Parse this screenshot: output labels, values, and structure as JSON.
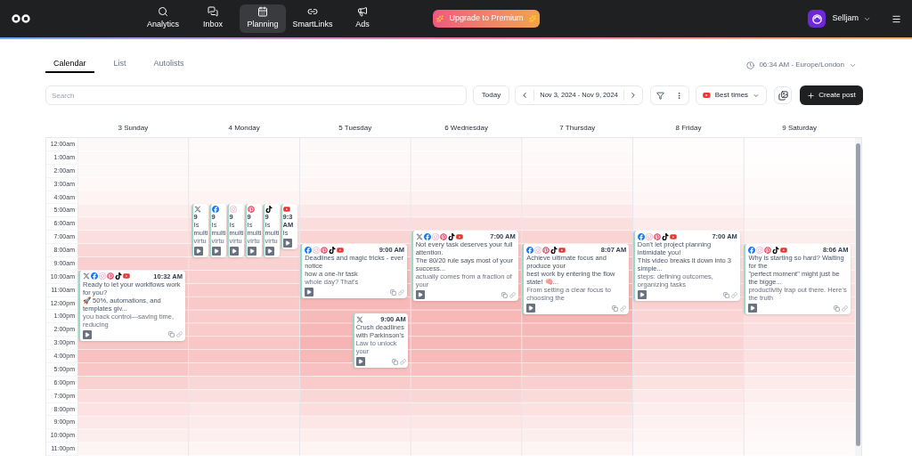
{
  "nav": [
    {
      "label": "Analytics",
      "selected": false
    },
    {
      "label": "Inbox",
      "selected": false
    },
    {
      "label": "Planning",
      "selected": true
    },
    {
      "label": "SmartLinks",
      "selected": false
    },
    {
      "label": "Ads",
      "selected": false
    }
  ],
  "upgrade": "Upgrade to Premium",
  "account": "Selljam",
  "views": [
    {
      "label": "Calendar",
      "selected": true
    },
    {
      "label": "List",
      "selected": false
    },
    {
      "label": "Autolists",
      "selected": false
    }
  ],
  "timezone": "06:34 AM - Europe/London",
  "search": {
    "placeholder": "Search"
  },
  "today": "Today",
  "range": "Nov 3, 2024 - Nov 9, 2024",
  "best_times": "Best times",
  "create": "Create post",
  "hours": [
    "12:00am",
    "1:00am",
    "2:00am",
    "3:00am",
    "4:00am",
    "5:00am",
    "6:00am",
    "7:00am",
    "8:00am",
    "9:00am",
    "10:00am",
    "11:00am",
    "12:00pm",
    "1:00pm",
    "2:00pm",
    "3:00pm",
    "4:00pm",
    "5:00pm",
    "6:00pm",
    "7:00pm",
    "8:00pm",
    "9:00pm",
    "10:00pm",
    "11:00pm"
  ],
  "days": [
    {
      "label": "3 Sunday",
      "posts": [
        {
          "kind": "full",
          "time": "10:32 AM",
          "networks": [
            {
              "kind": "x"
            },
            {
              "kind": "facebook"
            },
            {
              "kind": "instagram"
            },
            {
              "kind": "pinterest"
            },
            {
              "kind": "tiktok"
            },
            {
              "kind": "youtube"
            }
          ],
          "lines": [
            "Ready to let your workflows work for you?",
            "🚀 50%, automations, and templates giv...",
            "you back control—saving time, reducing"
          ]
        }
      ]
    },
    {
      "label": "4 Monday",
      "posts": [
        {
          "kind": "narrow",
          "time": "9",
          "networks": [
            {
              "kind": "x"
            }
          ],
          "lines": [
            "Is",
            "multi",
            "virtu"
          ]
        },
        {
          "kind": "narrow",
          "time": "9",
          "networks": [
            {
              "kind": "facebook"
            }
          ],
          "lines": [
            "Is",
            "multi",
            "virtu"
          ]
        },
        {
          "kind": "narrow",
          "time": "9",
          "networks": [
            {
              "kind": "instagram"
            }
          ],
          "lines": [
            "Is",
            "multi",
            "virtu"
          ]
        },
        {
          "kind": "narrow",
          "time": "9",
          "networks": [
            {
              "kind": "pinterest"
            }
          ],
          "lines": [
            "Is",
            "multi",
            "virtu"
          ]
        },
        {
          "kind": "narrow",
          "time": "9",
          "networks": [
            {
              "kind": "tiktok"
            }
          ],
          "lines": [
            "Is",
            "multi",
            "virtu"
          ]
        },
        {
          "kind": "narrow",
          "time": "9:3 AM",
          "networks": [
            {
              "kind": "youtube"
            }
          ],
          "lines": [
            "Is"
          ]
        }
      ]
    },
    {
      "label": "5 Tuesday",
      "posts": [
        {
          "kind": "full",
          "time": "9:00 AM",
          "networks": [
            {
              "kind": "facebook"
            },
            {
              "kind": "instagram"
            },
            {
              "kind": "pinterest"
            },
            {
              "kind": "tiktok"
            },
            {
              "kind": "youtube"
            }
          ],
          "lines": [
            "Deadlines and magic tricks - ever notice",
            "how a one-hr task",
            "whole day? That's"
          ]
        },
        {
          "kind": "half",
          "time": "9:00 AM",
          "networks": [
            {
              "kind": "x"
            }
          ],
          "lines": [
            "Crush deadlines",
            "with Parkinson's",
            "Law to unlock your"
          ]
        }
      ]
    },
    {
      "label": "6 Wednesday",
      "posts": [
        {
          "kind": "full",
          "time": "7:00 AM",
          "networks": [
            {
              "kind": "x"
            },
            {
              "kind": "facebook"
            },
            {
              "kind": "instagram"
            },
            {
              "kind": "pinterest"
            },
            {
              "kind": "tiktok"
            },
            {
              "kind": "youtube"
            }
          ],
          "lines": [
            "Not every task deserves your full attention.",
            "The 80/20 rule says most of your success...",
            "actually comes from a fraction of your"
          ]
        }
      ]
    },
    {
      "label": "7 Thursday",
      "posts": [
        {
          "kind": "full",
          "time": "8:07 AM",
          "networks": [
            {
              "kind": "facebook"
            },
            {
              "kind": "instagram"
            },
            {
              "kind": "pinterest"
            },
            {
              "kind": "tiktok"
            },
            {
              "kind": "youtube"
            }
          ],
          "lines": [
            "Achieve ultimate focus and produce your",
            "best work by entering the flow state! 🧠...",
            "From setting a clear focus to choosing the"
          ]
        }
      ]
    },
    {
      "label": "8 Friday",
      "posts": [
        {
          "kind": "full",
          "time": "7:00 AM",
          "networks": [
            {
              "kind": "facebook"
            },
            {
              "kind": "instagram"
            },
            {
              "kind": "pinterest"
            },
            {
              "kind": "tiktok"
            },
            {
              "kind": "youtube"
            }
          ],
          "lines": [
            "Don't let project planning intimidate you!",
            "This video breaks it down into 3 simple...",
            "steps: defining outcomes, organizing tasks"
          ]
        }
      ]
    },
    {
      "label": "9 Saturday",
      "posts": [
        {
          "kind": "full",
          "time": "8:06 AM",
          "networks": [
            {
              "kind": "facebook"
            },
            {
              "kind": "instagram"
            },
            {
              "kind": "pinterest"
            },
            {
              "kind": "tiktok"
            },
            {
              "kind": "youtube"
            }
          ],
          "lines": [
            "Why is starting so hard? Waiting for the",
            "\"perfect moment\" might just be the bigge...",
            "productivity trap out there. Here's the truth"
          ]
        }
      ]
    }
  ]
}
